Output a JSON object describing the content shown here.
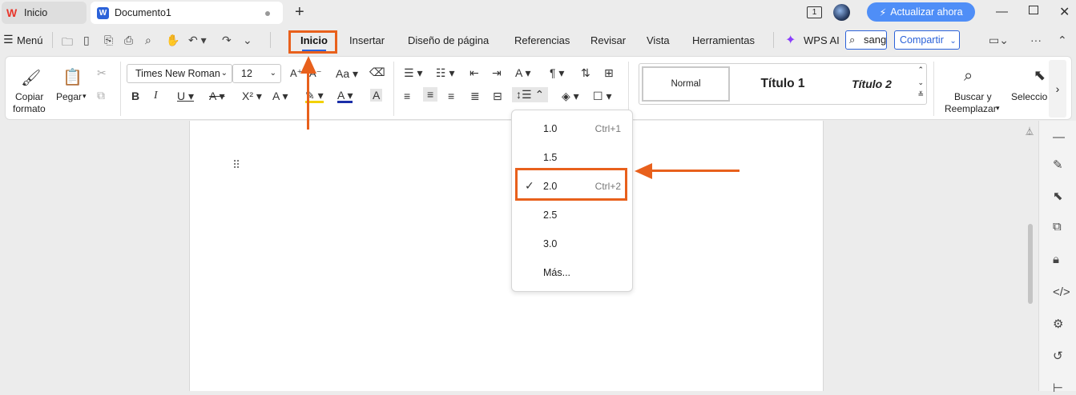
{
  "tabs": {
    "home_label": "Inicio",
    "doc_label": "Documento1",
    "doc_badge": "W",
    "new_tab_symbol": "+"
  },
  "titlebar": {
    "upgrade_label": "Actualizar ahora",
    "page_badge": "1"
  },
  "menubar": {
    "menu_label": "Menú",
    "items": [
      "Inicio",
      "Insertar",
      "Diseño de página",
      "Referencias",
      "Revisar",
      "Vista",
      "Herramientas"
    ],
    "wps_ai_label": "WPS AI",
    "search_value": "sang",
    "share_label": "Compartir"
  },
  "ribbon": {
    "copy_format_line1": "Copiar",
    "copy_format_line2": "formato",
    "paste_label": "Pegar",
    "font_name": "Times New Roman",
    "font_size": "12",
    "styles": [
      "Normal",
      "Título 1",
      "Título 2"
    ],
    "find_replace_line1": "Buscar y",
    "find_replace_line2": "Reemplazar",
    "select_label": "Seleccion"
  },
  "line_spacing_menu": {
    "options": [
      {
        "label": "1.0",
        "shortcut": "Ctrl+1"
      },
      {
        "label": "1.5",
        "shortcut": ""
      },
      {
        "label": "2.0",
        "shortcut": "Ctrl+2"
      },
      {
        "label": "2.5",
        "shortcut": ""
      },
      {
        "label": "3.0",
        "shortcut": ""
      },
      {
        "label": "Más...",
        "shortcut": ""
      }
    ],
    "selected": "2.0"
  },
  "colors": {
    "accent": "#2b62d9",
    "highlight": "#e8601c",
    "upgrade_bg": "#4f8ef7"
  }
}
